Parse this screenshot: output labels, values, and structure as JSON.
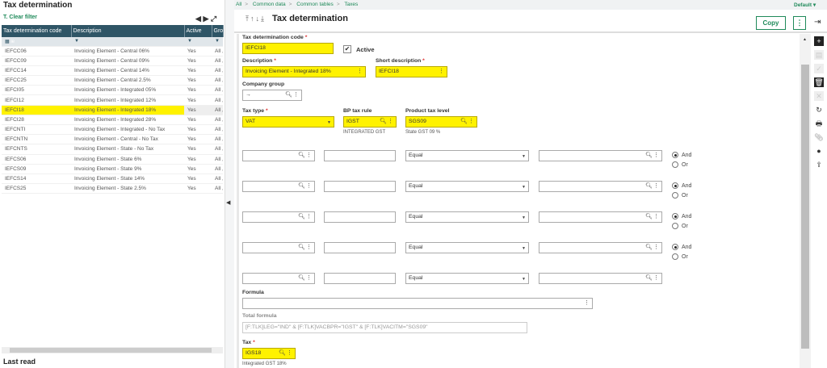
{
  "left": {
    "title": "Tax determination",
    "clear_filter": "Clear filter",
    "filter_value": "ie",
    "columns": [
      "Tax determination code",
      "Description",
      "Active",
      "Gro"
    ],
    "rows": [
      [
        "IEFCC06",
        "Invoicing Element - Central 06%",
        "Yes",
        "All ,"
      ],
      [
        "IEFCC09",
        "Invoicing Element - Central 09%",
        "Yes",
        "All ,"
      ],
      [
        "IEFCC14",
        "Invoicing Element - Central 14%",
        "Yes",
        "All ,"
      ],
      [
        "IEFCC25",
        "Invoicing Element - Central 2.5%",
        "Yes",
        "All ,"
      ],
      [
        "IEFCI05",
        "Invoicing Element - Integrated 05%",
        "Yes",
        "All ,"
      ],
      [
        "IEFCI12",
        "Invoicing Element - Integrated 12%",
        "Yes",
        "All ,"
      ],
      [
        "IEFCI18",
        "Invoicing Element - Integrated 18%",
        "Yes",
        "All ,"
      ],
      [
        "IEFCI28",
        "Invoicing Element - Integrated 28%",
        "Yes",
        "All ,"
      ],
      [
        "IEFCNTI",
        "Invoicing Element - Integrated - No Tax",
        "Yes",
        "All ,"
      ],
      [
        "IEFCNTN",
        "Invoicing Element - Central - No Tax",
        "Yes",
        "All ,"
      ],
      [
        "IEFCNTS",
        "Invoicing Element - State - No Tax",
        "Yes",
        "All ,"
      ],
      [
        "IEFCS06",
        "Invoicing Element - State 6%",
        "Yes",
        "All ,"
      ],
      [
        "IEFCS09",
        "Invoicing Element - State 9%",
        "Yes",
        "All ,"
      ],
      [
        "IEFCS14",
        "Invoicing Element - State 14%",
        "Yes",
        "All ,"
      ],
      [
        "IEFCS25",
        "Invoicing Element - State 2.5%",
        "Yes",
        "All ,"
      ]
    ],
    "selected_index": 6,
    "last_read": "Last read"
  },
  "breadcrumb": [
    "All",
    "Common data",
    "Common tables",
    "Taxes"
  ],
  "profile": "Default ▾",
  "header": {
    "title": "Tax determination",
    "copy": "Copy"
  },
  "form": {
    "code_label": "Tax determination code",
    "code": "IEFCI18",
    "active_label": "Active",
    "active": true,
    "desc_label": "Description",
    "desc": "Invoicing Element - Integrated 18%",
    "short_label": "Short description",
    "short": "IEFCI18",
    "company_group_label": "Company group",
    "company_group": "→",
    "tax_type_label": "Tax type",
    "tax_type": "VAT",
    "bp_rule_label": "BP tax rule",
    "bp_rule": "IGST",
    "bp_rule_desc": "INTEGRATED GST",
    "product_level_label": "Product tax level",
    "product_level": "SGS09",
    "product_level_desc": "State GST 09 %",
    "conditions": [
      {
        "op": "Equal",
        "link": "And"
      },
      {
        "op": "Equal",
        "link": "And"
      },
      {
        "op": "Equal",
        "link": "And"
      },
      {
        "op": "Equal",
        "link": "And"
      },
      {
        "op": "Equal"
      }
    ],
    "and_label": "And",
    "or_label": "Or",
    "formula_label": "Formula",
    "formula": "",
    "total_formula_label": "Total formula",
    "total_formula": "[F:TLK]LEG=\"IND\" & [F:TLK]VACBPR=\"IGST\" & [F:TLK]VACITM=\"SGS09\"",
    "tax_label": "Tax",
    "tax": "IGS18",
    "tax_desc": "Integrated GST 18%"
  }
}
